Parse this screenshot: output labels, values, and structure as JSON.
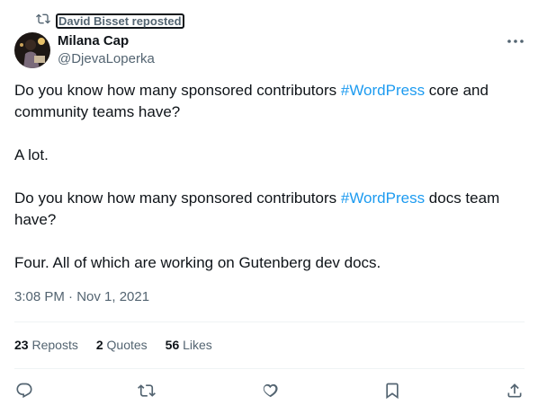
{
  "repost": {
    "label": "David Bisset reposted"
  },
  "author": {
    "name": "Milana Cap",
    "handle": "@DjevaLoperka"
  },
  "tweet": {
    "p1_before": "Do you know how many sponsored contributors ",
    "p1_tag": "#WordPress",
    "p1_after": " core and community teams have?",
    "p2": "A lot.",
    "p3_before": "Do you know how many sponsored contributors ",
    "p3_tag": "#WordPress",
    "p3_after": " docs team have?",
    "p4": "Four. All of which are working on Gutenberg dev docs."
  },
  "timestamp": "3:08 PM · Nov 1, 2021",
  "stats": {
    "reposts_count": "23",
    "reposts_label": "Reposts",
    "quotes_count": "2",
    "quotes_label": "Quotes",
    "likes_count": "56",
    "likes_label": "Likes"
  },
  "icons": {
    "repost": "repost-icon",
    "more": "more-icon",
    "reply": "reply-icon",
    "retweet": "retweet-icon",
    "like": "heart-icon",
    "bookmark": "bookmark-icon",
    "share": "share-icon"
  },
  "colors": {
    "link": "#1d9bf0",
    "muted": "#536471",
    "text": "#0f1419"
  }
}
